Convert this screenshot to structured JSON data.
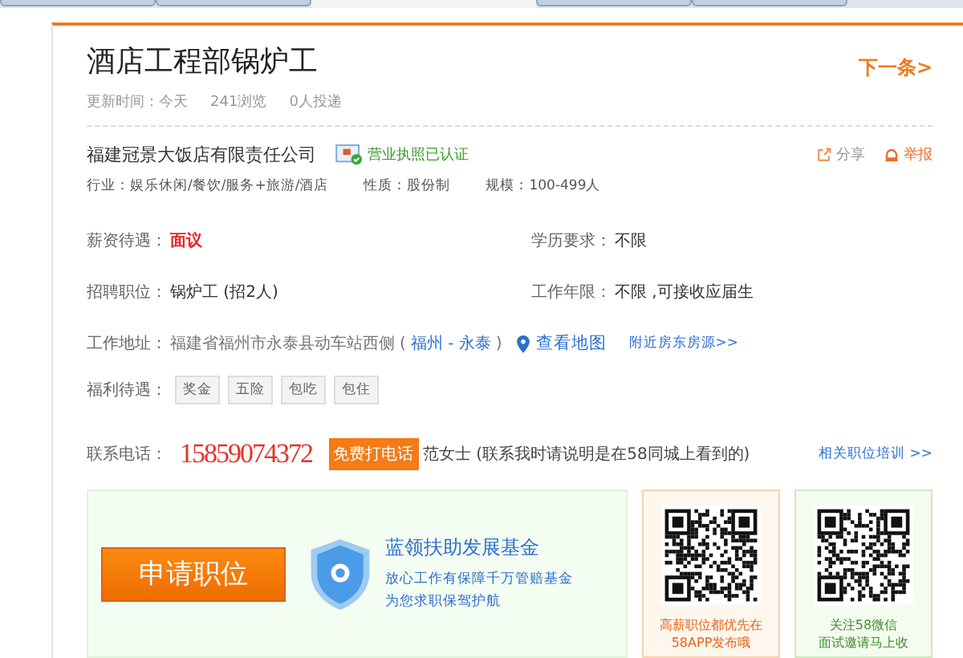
{
  "title": "酒店工程部锅炉工",
  "next_link": "下一条>",
  "meta": [
    {
      "label": "更新时间：",
      "value": "今天"
    },
    {
      "value": "241浏览"
    },
    {
      "value": "0人投递"
    }
  ],
  "company": {
    "name": "福建冠景大饭店有限责任公司",
    "verified": "营业执照已认证",
    "share": "分享",
    "report": "举报",
    "facts": [
      {
        "label": "行业：",
        "value": "娱乐休闲/餐饮/服务+旅游/酒店"
      },
      {
        "label": "性质：",
        "value": "股份制"
      },
      {
        "label": "规模：",
        "value": "100-499人"
      }
    ]
  },
  "details": [
    {
      "label": "薪资待遇：",
      "value": "面议",
      "kind": "highlight"
    },
    {
      "label": "学历要求：",
      "value": "不限",
      "kind": "plain"
    },
    {
      "label": "招聘职位：",
      "value": "锅炉工 (招2人)",
      "kind": "plain"
    },
    {
      "label": "工作年限：",
      "value": "不限 ,可接收应届生",
      "kind": "plain"
    }
  ],
  "address": {
    "label": "工作地址：",
    "text": "福建省福州市永泰县动车站西侧",
    "open": "(",
    "region": "福州 - 永泰",
    "close": ")",
    "map_link": "查看地图",
    "nearby_link": "附近房东房源>>"
  },
  "welfare": {
    "label": "福利待遇：",
    "tags": [
      "奖金",
      "五险",
      "包吃",
      "包住"
    ]
  },
  "contact": {
    "label": "联系电话：",
    "phone": "15859074372",
    "call_button": "免费打电话",
    "person": "范女士 (联系我时请说明是在58同城上看到的)",
    "related_link": "相关职位培训 >>"
  },
  "apply": {
    "button": "申请职位",
    "fund_title": "蓝领扶助发展基金",
    "fund_lines": [
      "放心工作有保障千万管赔基金",
      "为您求职保驾护航"
    ]
  },
  "qr_cards": [
    {
      "kind": "app",
      "lines": [
        "高薪职位都优先在",
        "58APP发布哦"
      ]
    },
    {
      "kind": "wechat",
      "lines": [
        "关注58微信",
        "面试邀请马上收"
      ]
    }
  ]
}
